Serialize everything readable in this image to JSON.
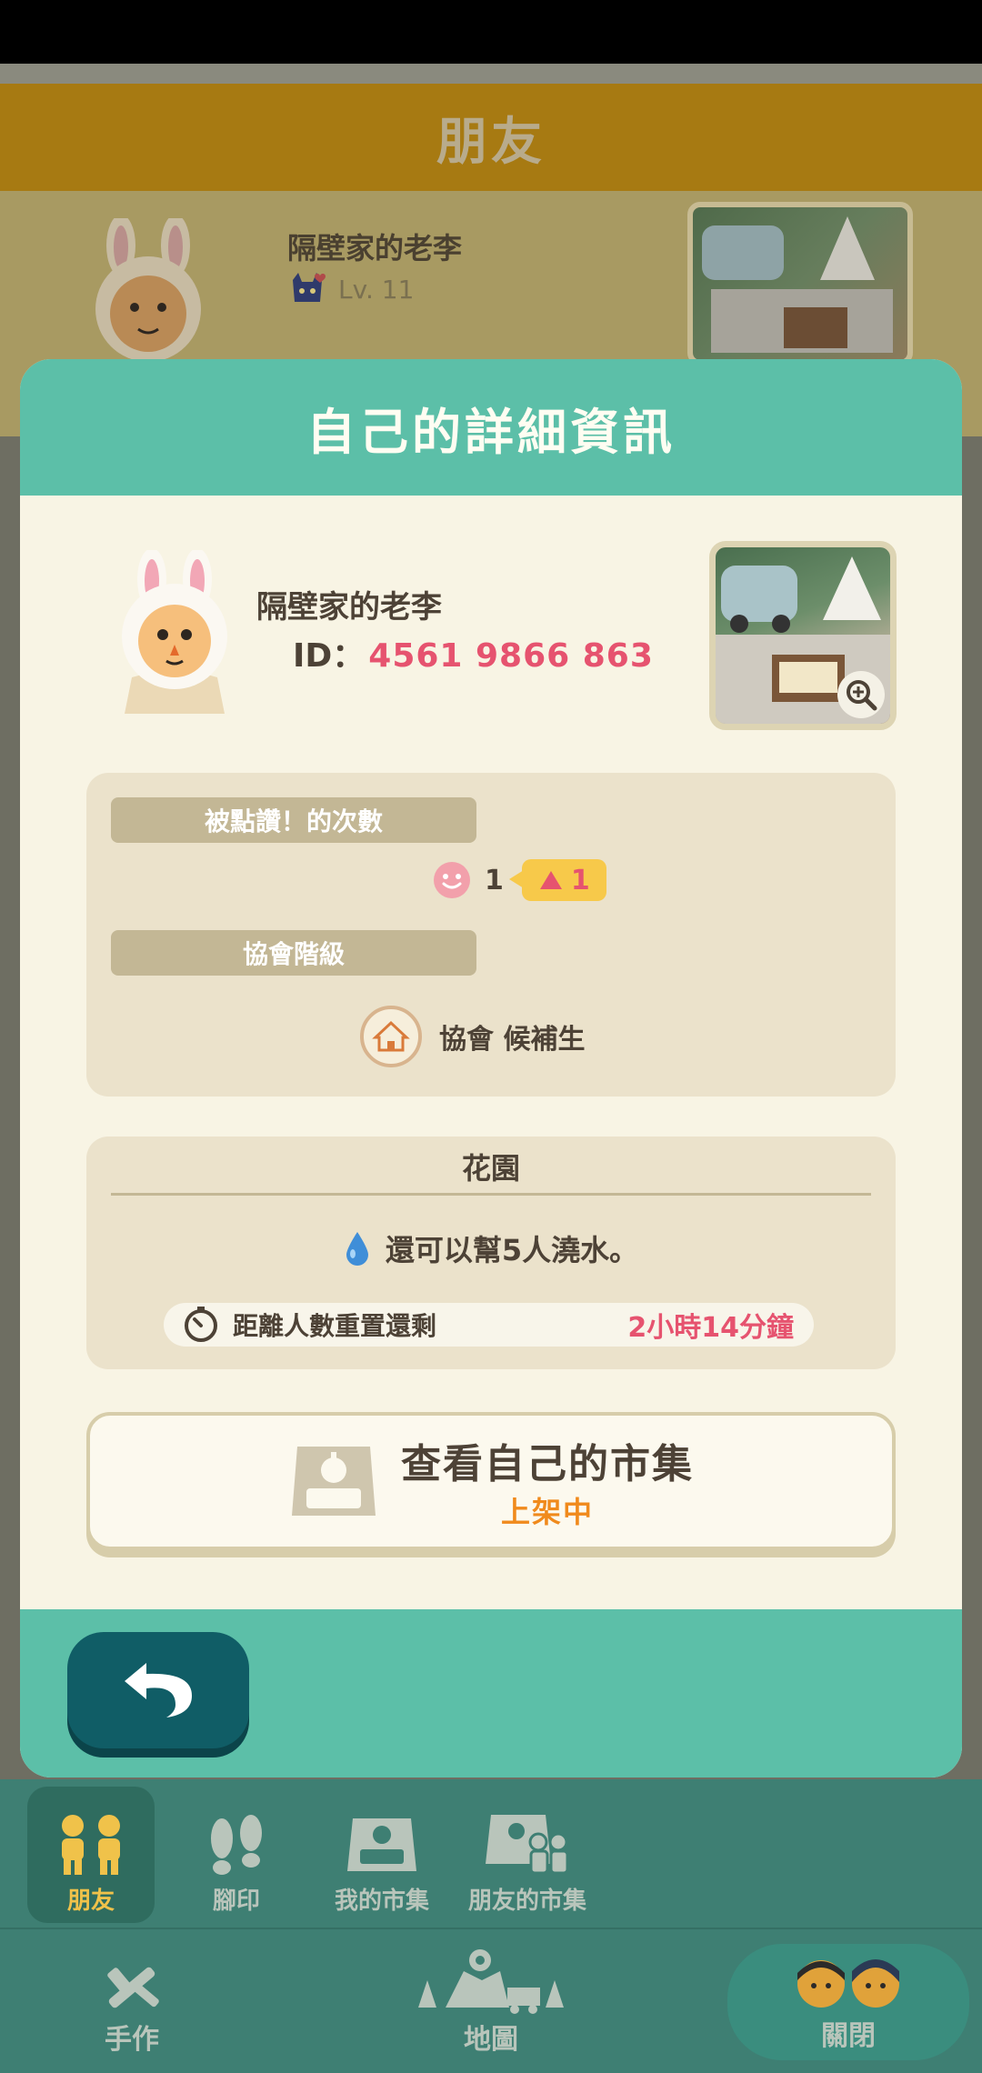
{
  "background": {
    "header_title": "朋友",
    "friend": {
      "name": "隔壁家的老李",
      "level": "Lv. 11"
    }
  },
  "modal": {
    "title": "自己的詳細資訊",
    "profile": {
      "name": "隔壁家的老李",
      "id_label": "ID：",
      "id_value": "4561 9866 863"
    },
    "stats": {
      "likes_label": "被點讚！的次數",
      "likes_count": "1",
      "likes_increase": "1",
      "rank_label": "協會階級",
      "rank_value": "協會 候補生"
    },
    "garden": {
      "title": "花園",
      "water_text": "還可以幫5人澆水。",
      "reset_label": "距離人數重置還剩",
      "reset_time": "2小時14分鐘"
    },
    "market_button": {
      "title": "查看自己的市集",
      "status": "上架中"
    }
  },
  "nav": {
    "top": [
      {
        "label": "朋友",
        "icon": "friends-icon",
        "active": true
      },
      {
        "label": "腳印",
        "icon": "footprints-icon"
      },
      {
        "label": "我的市集",
        "icon": "my-market-icon"
      },
      {
        "label": "朋友的市集",
        "icon": "friends-market-icon"
      }
    ],
    "bottom": [
      {
        "label": "手作",
        "icon": "craft-icon"
      },
      {
        "label": "地圖",
        "icon": "map-icon"
      },
      {
        "label": "關閉",
        "icon": "close-characters-icon"
      }
    ]
  },
  "colors": {
    "teal": "#5cbfa8",
    "accent_pink": "#e6536f",
    "accent_orange": "#f08a1c",
    "nav_bg": "#3e7f73",
    "modal_bg": "#f8f4e4"
  }
}
